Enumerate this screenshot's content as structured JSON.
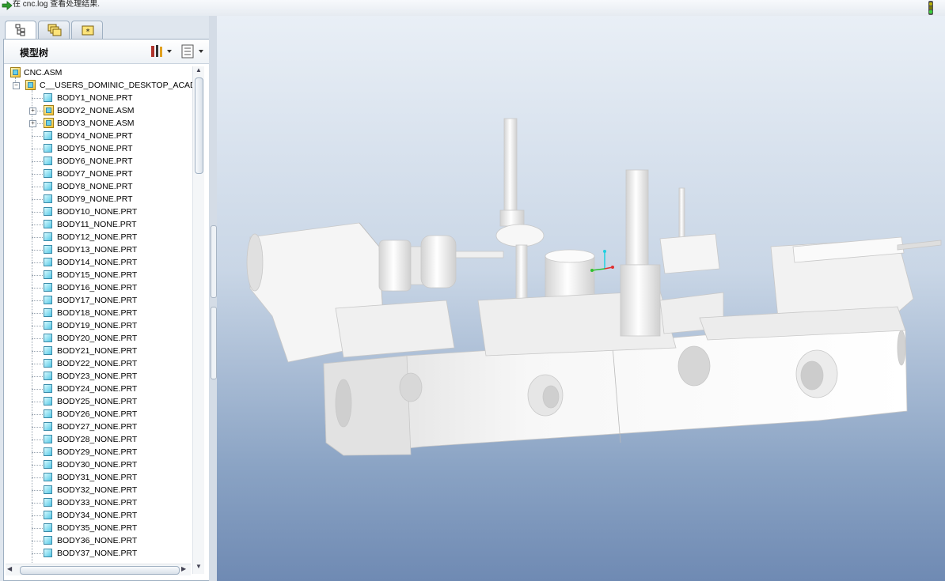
{
  "message_bar": {
    "text": "在 cnc.log 查看处理结果.",
    "icon": "arrow-right-icon",
    "status_icon": "traffic-light-icon"
  },
  "tabs": [
    {
      "name": "model-tree",
      "icon": "model-tree-icon",
      "active": true
    },
    {
      "name": "layers",
      "icon": "layers-icon",
      "active": false
    },
    {
      "name": "favorites",
      "icon": "star-folder-icon",
      "active": false
    }
  ],
  "tree": {
    "title": "模型树",
    "tools_icon": "tools-icon",
    "settings_icon": "show-settings-icon",
    "root": "CNC.ASM",
    "subassembly": "C__USERS_DOMINIC_DESKTOP_ACAD",
    "items": [
      {
        "label": "BODY1_NONE.PRT",
        "type": "part"
      },
      {
        "label": "BODY2_NONE.ASM",
        "type": "asm"
      },
      {
        "label": "BODY3_NONE.ASM",
        "type": "asm"
      },
      {
        "label": "BODY4_NONE.PRT",
        "type": "part"
      },
      {
        "label": "BODY5_NONE.PRT",
        "type": "part"
      },
      {
        "label": "BODY6_NONE.PRT",
        "type": "part"
      },
      {
        "label": "BODY7_NONE.PRT",
        "type": "part"
      },
      {
        "label": "BODY8_NONE.PRT",
        "type": "part"
      },
      {
        "label": "BODY9_NONE.PRT",
        "type": "part"
      },
      {
        "label": "BODY10_NONE.PRT",
        "type": "part"
      },
      {
        "label": "BODY11_NONE.PRT",
        "type": "part"
      },
      {
        "label": "BODY12_NONE.PRT",
        "type": "part"
      },
      {
        "label": "BODY13_NONE.PRT",
        "type": "part"
      },
      {
        "label": "BODY14_NONE.PRT",
        "type": "part"
      },
      {
        "label": "BODY15_NONE.PRT",
        "type": "part"
      },
      {
        "label": "BODY16_NONE.PRT",
        "type": "part"
      },
      {
        "label": "BODY17_NONE.PRT",
        "type": "part"
      },
      {
        "label": "BODY18_NONE.PRT",
        "type": "part"
      },
      {
        "label": "BODY19_NONE.PRT",
        "type": "part"
      },
      {
        "label": "BODY20_NONE.PRT",
        "type": "part"
      },
      {
        "label": "BODY21_NONE.PRT",
        "type": "part"
      },
      {
        "label": "BODY22_NONE.PRT",
        "type": "part"
      },
      {
        "label": "BODY23_NONE.PRT",
        "type": "part"
      },
      {
        "label": "BODY24_NONE.PRT",
        "type": "part"
      },
      {
        "label": "BODY25_NONE.PRT",
        "type": "part"
      },
      {
        "label": "BODY26_NONE.PRT",
        "type": "part"
      },
      {
        "label": "BODY27_NONE.PRT",
        "type": "part"
      },
      {
        "label": "BODY28_NONE.PRT",
        "type": "part"
      },
      {
        "label": "BODY29_NONE.PRT",
        "type": "part"
      },
      {
        "label": "BODY30_NONE.PRT",
        "type": "part"
      },
      {
        "label": "BODY31_NONE.PRT",
        "type": "part"
      },
      {
        "label": "BODY32_NONE.PRT",
        "type": "part"
      },
      {
        "label": "BODY33_NONE.PRT",
        "type": "part"
      },
      {
        "label": "BODY34_NONE.PRT",
        "type": "part"
      },
      {
        "label": "BODY35_NONE.PRT",
        "type": "part"
      },
      {
        "label": "BODY36_NONE.PRT",
        "type": "part"
      },
      {
        "label": "BODY37_NONE.PRT",
        "type": "part"
      }
    ]
  },
  "colors": {
    "viewport_top": "#e9eff6",
    "viewport_bottom": "#6f8ab3",
    "model": "#f2f2f2"
  }
}
